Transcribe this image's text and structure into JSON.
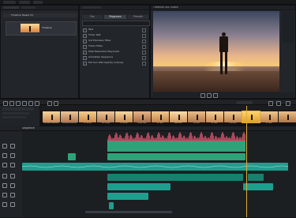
{
  "app": {
    "menu": [
      "",
      "",
      "",
      "",
      "",
      ""
    ]
  },
  "media_panel": {
    "tabs": [
      "",
      ""
    ],
    "items": [
      {
        "name": "Timeline Teaser 01"
      },
      {
        "name": "Timeline"
      }
    ]
  },
  "effects_panel": {
    "title": "",
    "tabs": [
      "Fav",
      "Programs",
      "Presets"
    ],
    "search_placeholder": "",
    "items": [
      {
        "label": "Text"
      },
      {
        "label": "Timer Text"
      },
      {
        "label": "Cut Premiere Titles"
      },
      {
        "label": "Ticker Titles"
      },
      {
        "label": "Pixel Resolution Playmode"
      },
      {
        "label": "Animation Sequence"
      },
      {
        "label": "Full Sun 4Hz Opacity Cultures"
      }
    ]
  },
  "viewer": {
    "title": "Timeline Still Tiltate",
    "timecode": ""
  },
  "timeline": {
    "sequence_name": "Sequence",
    "playhead_label": "",
    "filmstrip_captions": [
      "Mouse Museum",
      "Prairie Ground",
      "In Strip",
      "Gh Strip",
      "In Strip",
      "Clide Gim",
      "In Gim",
      "Gie Gim",
      "In Zoo",
      "In Gim",
      "Ha Gim",
      "",
      "In Gim",
      ""
    ]
  },
  "colors": {
    "accent": "#e2a93a",
    "clip_teal": "#1f9e8e",
    "clip_green": "#2ea37a",
    "waveform": "#c9556b"
  }
}
